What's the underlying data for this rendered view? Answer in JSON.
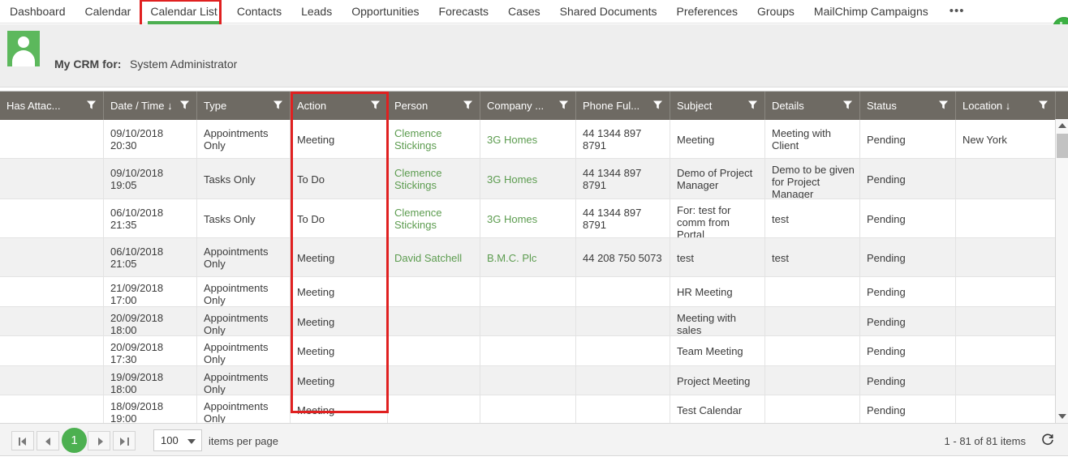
{
  "nav": {
    "items": [
      {
        "label": "Dashboard",
        "active": false
      },
      {
        "label": "Calendar",
        "active": false
      },
      {
        "label": "Calendar List",
        "active": true
      },
      {
        "label": "Contacts",
        "active": false
      },
      {
        "label": "Leads",
        "active": false
      },
      {
        "label": "Opportunities",
        "active": false
      },
      {
        "label": "Forecasts",
        "active": false
      },
      {
        "label": "Cases",
        "active": false
      },
      {
        "label": "Shared Documents",
        "active": false
      },
      {
        "label": "Preferences",
        "active": false
      },
      {
        "label": "Groups",
        "active": false
      },
      {
        "label": "MailChimp Campaigns",
        "active": false
      }
    ],
    "overflow_label": "•••"
  },
  "header": {
    "crm_label": "My CRM for:",
    "crm_user": "System Administrator",
    "avatar_icon": "user-avatar-icon",
    "accent_color": "#4cb050",
    "annotation_color": "#e02020"
  },
  "grid": {
    "columns": [
      {
        "label": "Has Attac...",
        "filter_icon": "filter-icon",
        "sort": ""
      },
      {
        "label": "Date / Time",
        "filter_icon": "filter-icon",
        "sort": "↓"
      },
      {
        "label": "Type",
        "filter_icon": "filter-icon",
        "sort": ""
      },
      {
        "label": "Action",
        "filter_icon": "filter-icon",
        "sort": ""
      },
      {
        "label": "Person",
        "filter_icon": "filter-icon",
        "sort": ""
      },
      {
        "label": "Company ...",
        "filter_icon": "filter-icon",
        "sort": ""
      },
      {
        "label": "Phone Ful...",
        "filter_icon": "filter-icon",
        "sort": ""
      },
      {
        "label": "Subject",
        "filter_icon": "filter-icon",
        "sort": ""
      },
      {
        "label": "Details",
        "filter_icon": "filter-icon",
        "sort": ""
      },
      {
        "label": "Status",
        "filter_icon": "filter-icon",
        "sort": ""
      },
      {
        "label": "Location",
        "filter_icon": "filter-icon",
        "sort": "↓"
      }
    ],
    "rows": [
      {
        "has_attachment": "",
        "datetime": "09/10/2018 20:30",
        "type": "Appointments Only",
        "action": "Meeting",
        "person": "Clemence Stickings",
        "company": "3G Homes",
        "phone": "44 1344 897 8791",
        "subject": "Meeting",
        "details": "Meeting with Client",
        "status": "Pending",
        "location": "New York"
      },
      {
        "has_attachment": "",
        "datetime": "09/10/2018 19:05",
        "type": "Tasks Only",
        "action": "To Do",
        "person": "Clemence Stickings",
        "company": "3G Homes",
        "phone": "44 1344 897 8791",
        "subject": "Demo of Project Manager",
        "details": "Demo to be given for Project Manager",
        "status": "Pending",
        "location": ""
      },
      {
        "has_attachment": "",
        "datetime": "06/10/2018 21:35",
        "type": "Tasks Only",
        "action": "To Do",
        "person": "Clemence Stickings",
        "company": "3G Homes",
        "phone": "44 1344 897 8791",
        "subject": "For: test for comm from Portal Appointment",
        "details": "test",
        "status": "Pending",
        "location": ""
      },
      {
        "has_attachment": "",
        "datetime": "06/10/2018 21:05",
        "type": "Appointments Only",
        "action": "Meeting",
        "person": "David Satchell",
        "company": "B.M.C. Plc",
        "phone": "44 208 750 5073",
        "subject": "test",
        "details": "test",
        "status": "Pending",
        "location": ""
      },
      {
        "has_attachment": "",
        "datetime": "21/09/2018 17:00",
        "type": "Appointments Only",
        "action": "Meeting",
        "person": "",
        "company": "",
        "phone": "",
        "subject": "HR Meeting",
        "details": "",
        "status": "Pending",
        "location": ""
      },
      {
        "has_attachment": "",
        "datetime": "20/09/2018 18:00",
        "type": "Appointments Only",
        "action": "Meeting",
        "person": "",
        "company": "",
        "phone": "",
        "subject": "Meeting with sales management team",
        "details": "",
        "status": "Pending",
        "location": ""
      },
      {
        "has_attachment": "",
        "datetime": "20/09/2018 17:30",
        "type": "Appointments Only",
        "action": "Meeting",
        "person": "",
        "company": "",
        "phone": "",
        "subject": "Team Meeting",
        "details": "",
        "status": "Pending",
        "location": ""
      },
      {
        "has_attachment": "",
        "datetime": "19/09/2018 18:00",
        "type": "Appointments Only",
        "action": "Meeting",
        "person": "",
        "company": "",
        "phone": "",
        "subject": "Project Meeting",
        "details": "",
        "status": "Pending",
        "location": ""
      },
      {
        "has_attachment": "",
        "datetime": "18/09/2018 19:00",
        "type": "Appointments Only",
        "action": "Meeting",
        "person": "",
        "company": "",
        "phone": "",
        "subject": "Test Calendar",
        "details": "",
        "status": "Pending",
        "location": ""
      }
    ]
  },
  "pager": {
    "first_label": "first-page",
    "prev_label": "previous-page",
    "current_page": "1",
    "next_label": "next-page",
    "last_label": "last-page",
    "page_size": "100",
    "items_per_page_label": "items per page",
    "range_label": "1 - 81 of 81 items",
    "refresh_icon": "refresh-icon"
  }
}
